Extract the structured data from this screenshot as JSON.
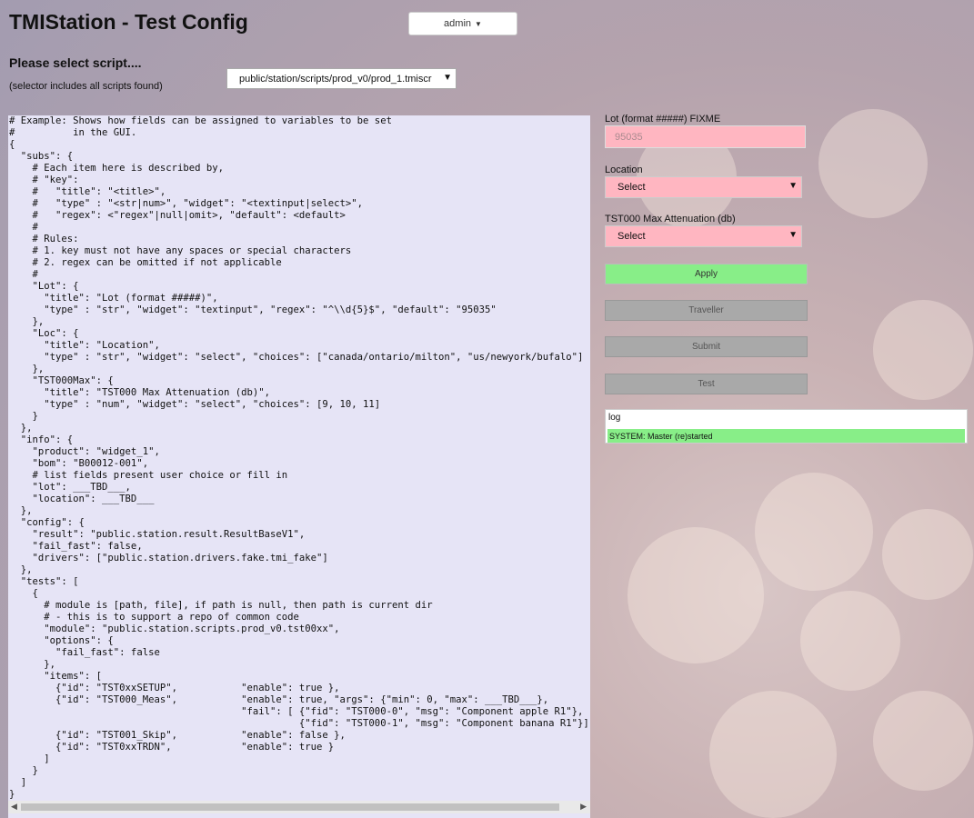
{
  "app": {
    "title": "TMIStation - Test Config",
    "user_label": "admin"
  },
  "script_selector": {
    "label": "Please select script....",
    "hint": "(selector includes all scripts found)",
    "selected": "public/station/scripts/prod_v0/prod_1.tmiscr"
  },
  "code": "# Example: Shows how fields can be assigned to variables to be set\n#          in the GUI.\n{\n  \"subs\": {\n    # Each item here is described by,\n    # \"key\":\n    #   \"title\": \"<title>\",\n    #   \"type\" : \"<str|num>\", \"widget\": \"<textinput|select>\",\n    #   \"regex\": <\"regex\"|null|omit>, \"default\": <default>\n    #\n    # Rules:\n    # 1. key must not have any spaces or special characters\n    # 2. regex can be omitted if not applicable\n    #\n    \"Lot\": {\n      \"title\": \"Lot (format #####)\",\n      \"type\" : \"str\", \"widget\": \"textinput\", \"regex\": \"^\\\\d{5}$\", \"default\": \"95035\"\n    },\n    \"Loc\": {\n      \"title\": \"Location\",\n      \"type\" : \"str\", \"widget\": \"select\", \"choices\": [\"canada/ontario/milton\", \"us/newyork/bufalo\"]\n    },\n    \"TST000Max\": {\n      \"title\": \"TST000 Max Attenuation (db)\",\n      \"type\" : \"num\", \"widget\": \"select\", \"choices\": [9, 10, 11]\n    }\n  },\n  \"info\": {\n    \"product\": \"widget_1\",\n    \"bom\": \"B00012-001\",\n    # list fields present user choice or fill in\n    \"lot\": ___TBD___,\n    \"location\": ___TBD___\n  },\n  \"config\": {\n    \"result\": \"public.station.result.ResultBaseV1\",\n    \"fail_fast\": false,\n    \"drivers\": [\"public.station.drivers.fake.tmi_fake\"]\n  },\n  \"tests\": [\n    {\n      # module is [path, file], if path is null, then path is current dir\n      # - this is to support a repo of common code\n      \"module\": \"public.station.scripts.prod_v0.tst00xx\",\n      \"options\": {\n        \"fail_fast\": false\n      },\n      \"items\": [\n        {\"id\": \"TST0xxSETUP\",           \"enable\": true },\n        {\"id\": \"TST000_Meas\",           \"enable\": true, \"args\": {\"min\": 0, \"max\": ___TBD___},\n                                        \"fail\": [ {\"fid\": \"TST000-0\", \"msg\": \"Component apple R1\"},\n                                                  {\"fid\": \"TST000-1\", \"msg\": \"Component banana R1\"}]\n        {\"id\": \"TST001_Skip\",           \"enable\": false },\n        {\"id\": \"TST0xxTRDN\",            \"enable\": true }\n      ]\n    }\n  ]\n}",
  "form": {
    "lot_label": "Lot (format #####) FIXME",
    "lot_placeholder": "95035",
    "location_label": "Location",
    "location_selected": "Select",
    "max_label": "TST000 Max Attenuation (db)",
    "max_selected": "Select"
  },
  "buttons": {
    "apply": "Apply",
    "traveller": "Traveller",
    "submit": "Submit",
    "test": "Test"
  },
  "log": {
    "title": "log",
    "entries": [
      "SYSTEM: Master (re)started"
    ]
  },
  "colors": {
    "field_bg": "#ffb6c1",
    "apply_green": "#88ee88",
    "disabled_grey": "#a9a9a9",
    "code_bg": "#e6e4f6"
  },
  "icons": {
    "dropdown": "caret-down-icon"
  }
}
